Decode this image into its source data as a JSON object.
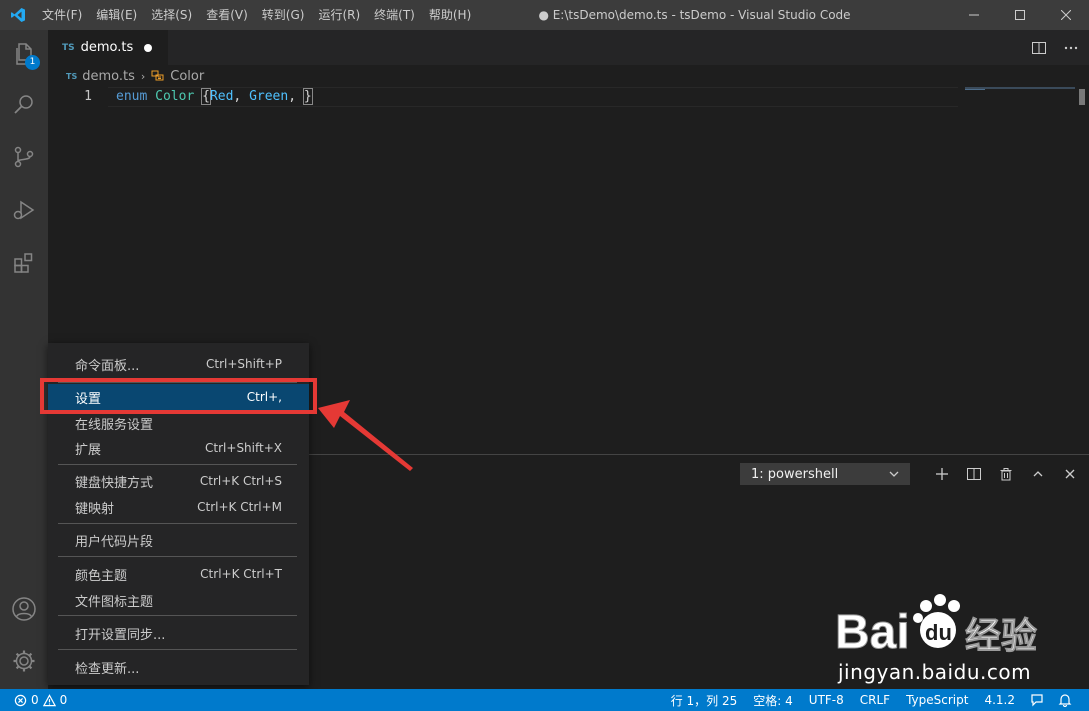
{
  "titlebar": {
    "menu": [
      "文件(F)",
      "编辑(E)",
      "选择(S)",
      "查看(V)",
      "转到(G)",
      "运行(R)",
      "终端(T)",
      "帮助(H)"
    ],
    "window_title": "● E:\\tsDemo\\demo.ts - tsDemo - Visual Studio Code"
  },
  "activitybar": {
    "icons": [
      "files-icon",
      "search-icon",
      "source-control-icon",
      "run-debug-icon",
      "extensions-icon",
      "accounts-icon",
      "manage-gear-icon"
    ],
    "explorer_badge": "1"
  },
  "tabs": [
    {
      "icon_text": "TS",
      "label": "demo.ts",
      "dirty": true
    }
  ],
  "breadcrumb": {
    "icon_text": "TS",
    "file": "demo.ts",
    "symbol": "Color"
  },
  "editor": {
    "line_number": "1",
    "tokens": {
      "keyword": "enum",
      "name": "Color",
      "open": "{",
      "m1": "Red",
      "c1": ",",
      "m2": "Green",
      "c2": ",",
      "close": "}"
    }
  },
  "panel": {
    "terminal_select": "1: powershell"
  },
  "context_menu": {
    "items": [
      {
        "label": "命令面板...",
        "shortcut": "Ctrl+Shift+P"
      },
      {
        "label": "设置",
        "shortcut": "Ctrl+,"
      },
      {
        "label": "在线服务设置",
        "shortcut": ""
      },
      {
        "label": "扩展",
        "shortcut": "Ctrl+Shift+X"
      },
      {
        "label": "键盘快捷方式",
        "shortcut": "Ctrl+K Ctrl+S"
      },
      {
        "label": "键映射",
        "shortcut": "Ctrl+K Ctrl+M"
      },
      {
        "label": "用户代码片段",
        "shortcut": ""
      },
      {
        "label": "颜色主题",
        "shortcut": "Ctrl+K Ctrl+T"
      },
      {
        "label": "文件图标主题",
        "shortcut": ""
      },
      {
        "label": "打开设置同步...",
        "shortcut": ""
      },
      {
        "label": "检查更新...",
        "shortcut": ""
      }
    ],
    "selected_index": 1
  },
  "statusbar": {
    "errors": "0",
    "warnings": "0",
    "position": "行 1，列 25",
    "indent": "空格: 4",
    "encoding": "UTF-8",
    "eol": "CRLF",
    "language": "TypeScript",
    "version": "4.1.2"
  },
  "watermark": {
    "logo_text": "Bai du 经验",
    "url": "jingyan.baidu.com"
  },
  "colors": {
    "accent": "#007acc",
    "highlight": "#e53935",
    "selected_item": "#094771"
  }
}
